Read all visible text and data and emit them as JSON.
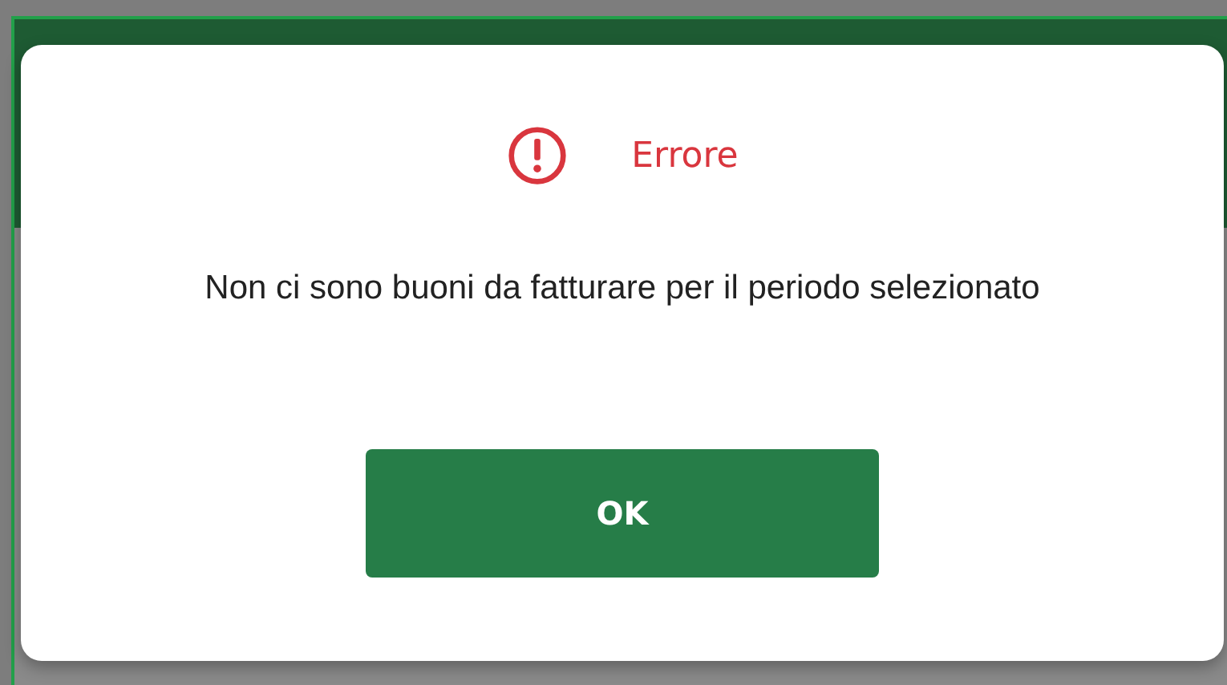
{
  "dialog": {
    "title": "Errore",
    "message": "Non ci sono buoni da fatturare per il periodo selezionato",
    "buttons": [
      "OK"
    ]
  }
}
